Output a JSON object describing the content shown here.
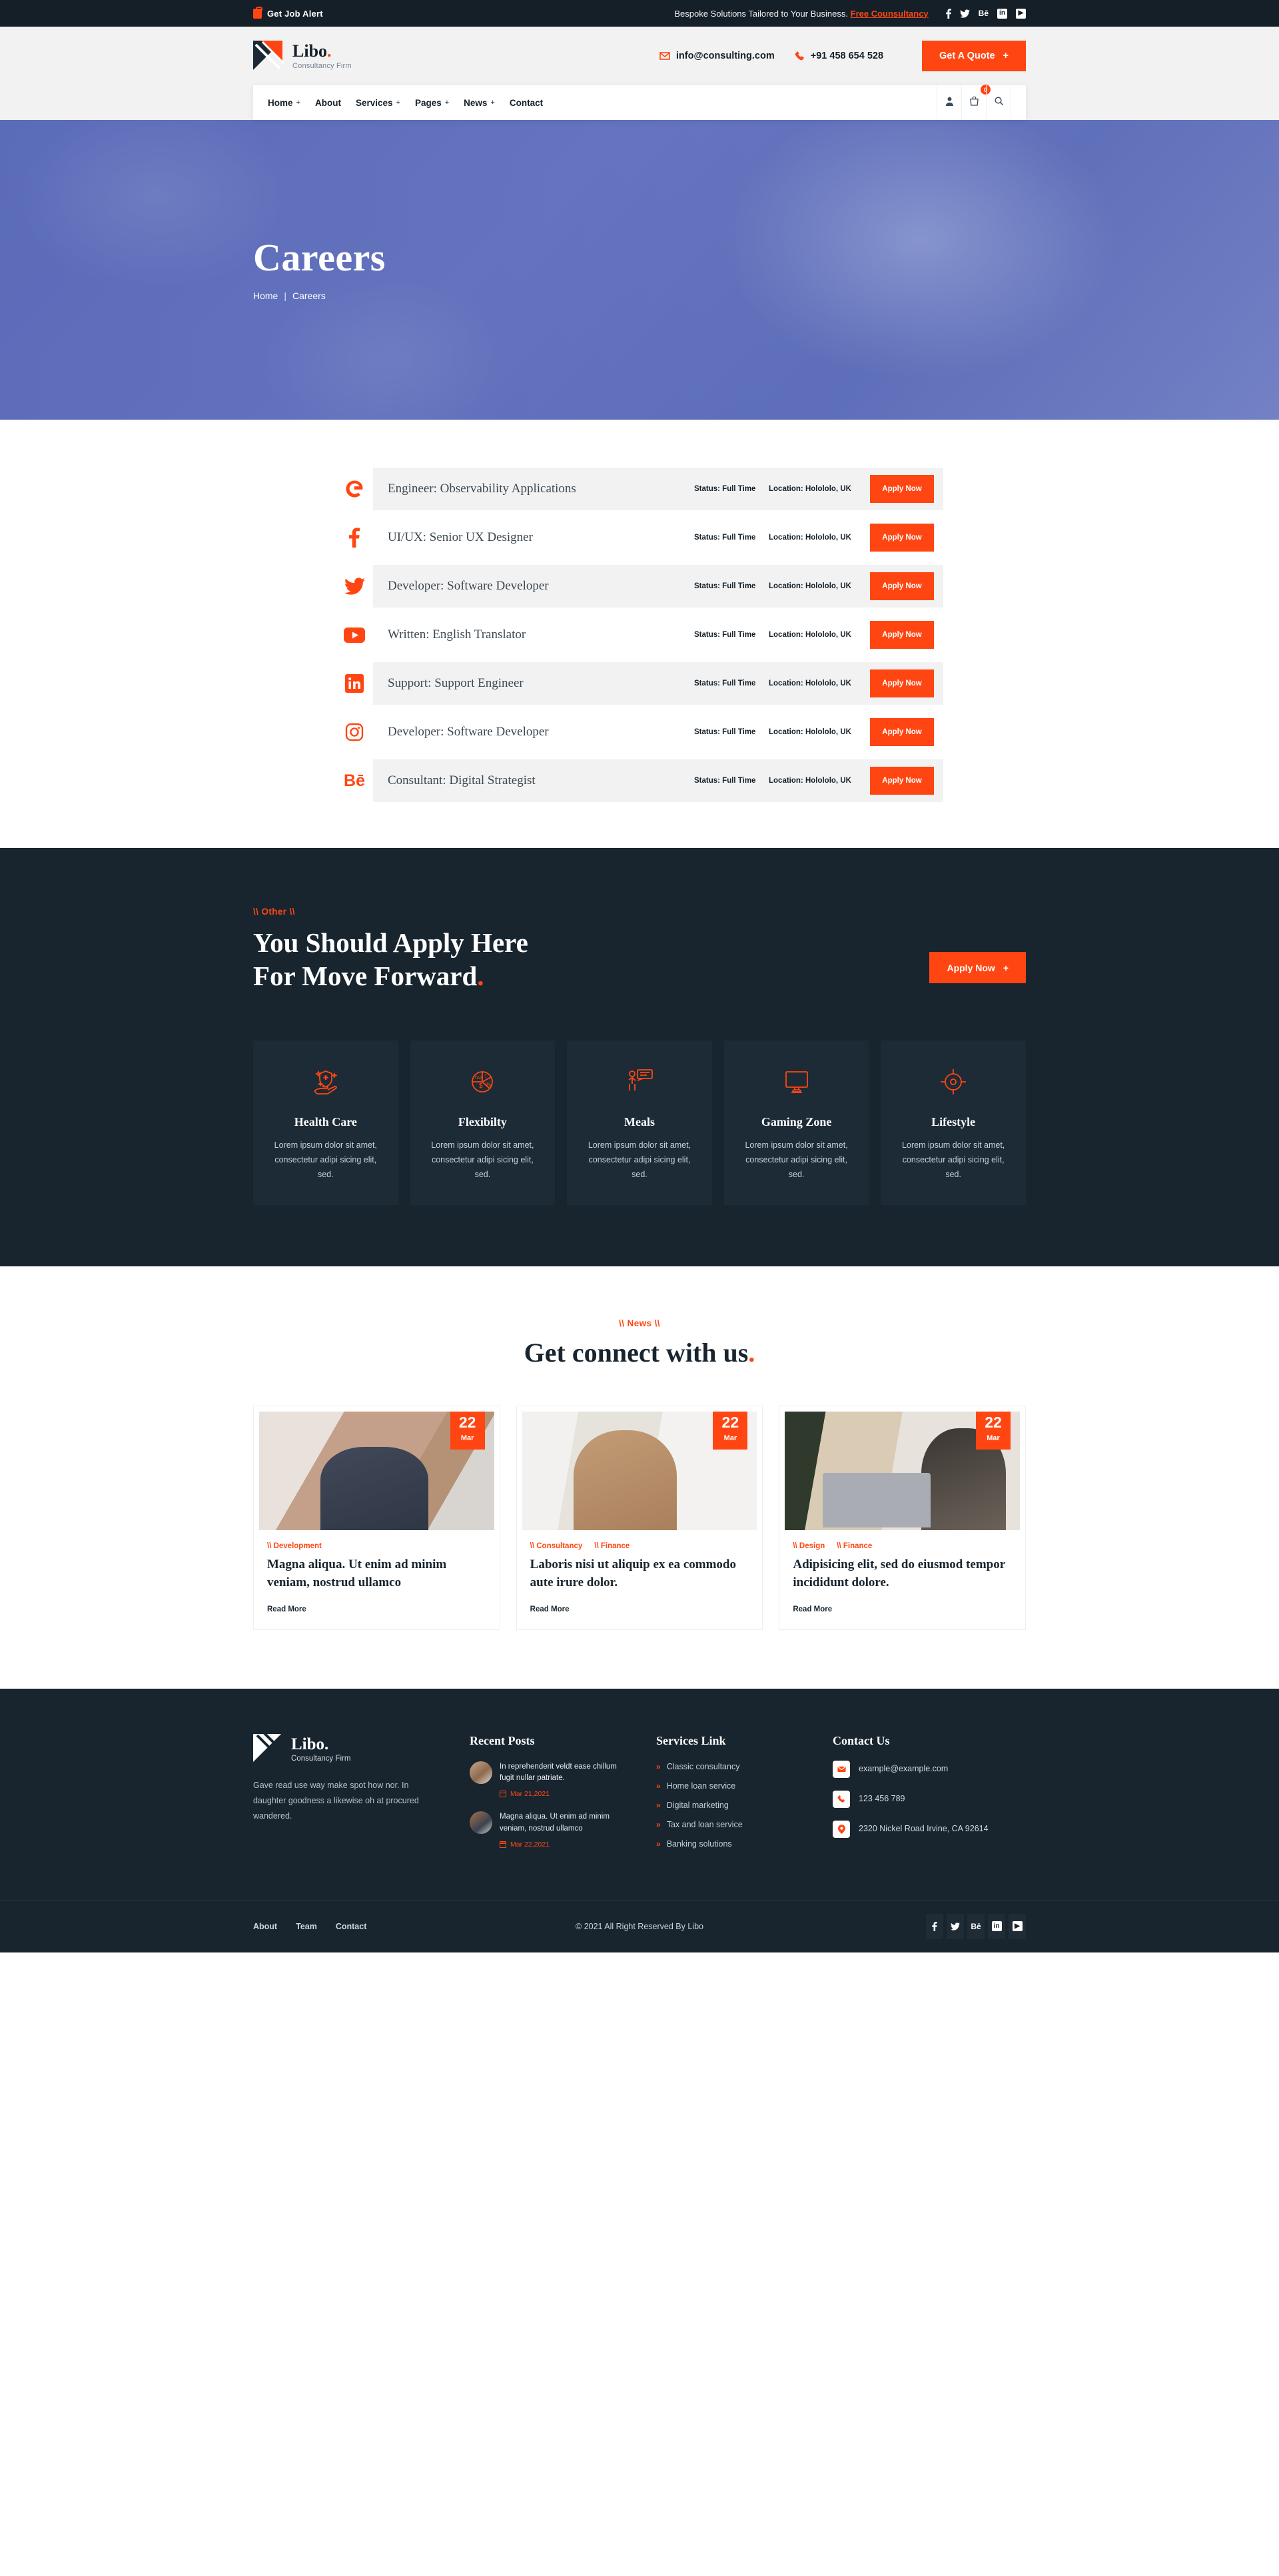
{
  "topbar": {
    "job_alert": "Get Job Alert",
    "tagline": "Bespoke Solutions Tailored to Your Business.",
    "tagline_link": "Free Counsultancy",
    "socials": [
      "facebook-icon",
      "twitter-icon",
      "behance-icon",
      "linkedin-icon",
      "youtube-icon"
    ]
  },
  "header": {
    "brand_name": "Libo",
    "brand_dot": ".",
    "brand_sub": "Consultancy Firm",
    "email": "info@consulting.com",
    "phone": "+91 458 654 528",
    "quote_label": "Get A Quote",
    "quote_plus": "+"
  },
  "nav": {
    "items": [
      {
        "label": "Home",
        "plus": "+"
      },
      {
        "label": "About",
        "plus": ""
      },
      {
        "label": "Services",
        "plus": "+"
      },
      {
        "label": "Pages",
        "plus": "+"
      },
      {
        "label": "News",
        "plus": "+"
      },
      {
        "label": "Contact",
        "plus": ""
      }
    ],
    "cart_count": "0"
  },
  "hero": {
    "title": "Careers",
    "crumb_home": "Home",
    "crumb_sep": "|",
    "crumb_current": "Careers"
  },
  "jobs": {
    "rows": [
      {
        "logo": "google-icon",
        "glyph": "G",
        "title": "Engineer: Observability Applications",
        "status": "Status: Full Time",
        "location": "Location: Holololo, UK",
        "apply": "Apply Now",
        "alt": true
      },
      {
        "logo": "facebook-icon",
        "glyph": "f",
        "title": "UI/UX: Senior UX Designer",
        "status": "Status: Full Time",
        "location": "Location: Holololo, UK",
        "apply": "Apply Now",
        "alt": false
      },
      {
        "logo": "twitter-icon",
        "glyph": "t",
        "title": "Developer: Software Developer",
        "status": "Status: Full Time",
        "location": "Location: Holololo, UK",
        "apply": "Apply Now",
        "alt": true
      },
      {
        "logo": "youtube-icon",
        "glyph": "y",
        "title": "Written: English Translator",
        "status": "Status: Full Time",
        "location": "Location: Holololo, UK",
        "apply": "Apply Now",
        "alt": false
      },
      {
        "logo": "linkedin-icon",
        "glyph": "in",
        "title": "Support: Support Engineer",
        "status": "Status: Full Time",
        "location": "Location: Holololo, UK",
        "apply": "Apply Now",
        "alt": true
      },
      {
        "logo": "instagram-icon",
        "glyph": "o",
        "title": "Developer: Software Developer",
        "status": "Status: Full Time",
        "location": "Location: Holololo, UK",
        "apply": "Apply Now",
        "alt": false
      },
      {
        "logo": "behance-icon",
        "glyph": "Be",
        "title": "Consultant: Digital Strategist",
        "status": "Status: Full Time",
        "location": "Location: Holololo, UK",
        "apply": "Apply Now",
        "alt": true
      }
    ]
  },
  "apply_section": {
    "label": "\\\\ Other \\\\",
    "heading_line1": "You Should Apply Here",
    "heading_line2": "For Move Forward",
    "heading_dot": ".",
    "button": "Apply Now",
    "button_plus": "+",
    "benefits": [
      {
        "icon": "health-shield-icon",
        "title": "Health Care",
        "text": "Lorem ipsum dolor sit amet, consectetur adipi sicing elit, sed."
      },
      {
        "icon": "tax-pie-chart-icon",
        "title": "Flexibilty",
        "text": "Lorem ipsum dolor sit amet, consectetur adipi sicing elit, sed."
      },
      {
        "icon": "presentation-icon",
        "title": "Meals",
        "text": "Lorem ipsum dolor sit amet, consectetur adipi sicing elit, sed."
      },
      {
        "icon": "monitor-icon",
        "title": "Gaming Zone",
        "text": "Lorem ipsum dolor sit amet, consectetur adipi sicing elit, sed."
      },
      {
        "icon": "target-icon",
        "title": "Lifestyle",
        "text": "Lorem ipsum dolor sit amet, consectetur adipi sicing elit, sed."
      }
    ]
  },
  "news": {
    "label": "\\\\ News \\\\",
    "heading": "Get connect with us",
    "heading_dot": ".",
    "cards": [
      {
        "day": "22",
        "month": "Mar",
        "tags": [
          "\\\\ Development"
        ],
        "title": "Magna aliqua. Ut enim ad minim veniam, nostrud ullamco",
        "read_more": "Read More"
      },
      {
        "day": "22",
        "month": "Mar",
        "tags": [
          "\\\\ Consultancy",
          "\\\\ Finance"
        ],
        "title": "Laboris nisi ut aliquip ex ea commodo aute irure dolor.",
        "read_more": "Read More"
      },
      {
        "day": "22",
        "month": "Mar",
        "tags": [
          "\\\\ Design",
          "\\\\ Finance"
        ],
        "title": "Adipisicing elit, sed do eiusmod tempor incididunt dolore.",
        "read_more": "Read More"
      }
    ]
  },
  "footer": {
    "brand_name": "Libo.",
    "brand_sub": "Consultancy Firm",
    "about": "Gave read use way make spot how nor. In daughter goodness a likewise oh at procured wandered.",
    "recent_posts_title": "Recent Posts",
    "posts": [
      {
        "text": "In reprehenderit veldt ease chillum fugit nullar patriate.",
        "date": "Mar 21,2021"
      },
      {
        "text": "Magna aliqua. Ut enim ad minim veniam, nostrud ullamco",
        "date": "Mar 22,2021"
      }
    ],
    "services_title": "Services Link",
    "services": [
      "Classic consultancy",
      "Home loan service",
      "Digital marketing",
      "Tax and loan service",
      "Banking solutions"
    ],
    "contact_title": "Contact Us",
    "contact": [
      {
        "icon": "mail-icon",
        "value": "example@example.com"
      },
      {
        "icon": "phone-icon",
        "value": "123 456 789"
      },
      {
        "icon": "location-pin-icon",
        "value": "2320 Nickel Road Irvine, CA 92614"
      }
    ],
    "bottom_links": [
      "About",
      "Team",
      "Contact"
    ],
    "copyright": "© 2021 All Right Reserved By Libo",
    "socials": [
      "facebook-icon",
      "twitter-icon",
      "behance-icon",
      "linkedin-icon",
      "youtube-icon"
    ]
  },
  "colors": {
    "accent": "#ff4612",
    "dark": "#18252f",
    "topbar": "#141f28"
  }
}
